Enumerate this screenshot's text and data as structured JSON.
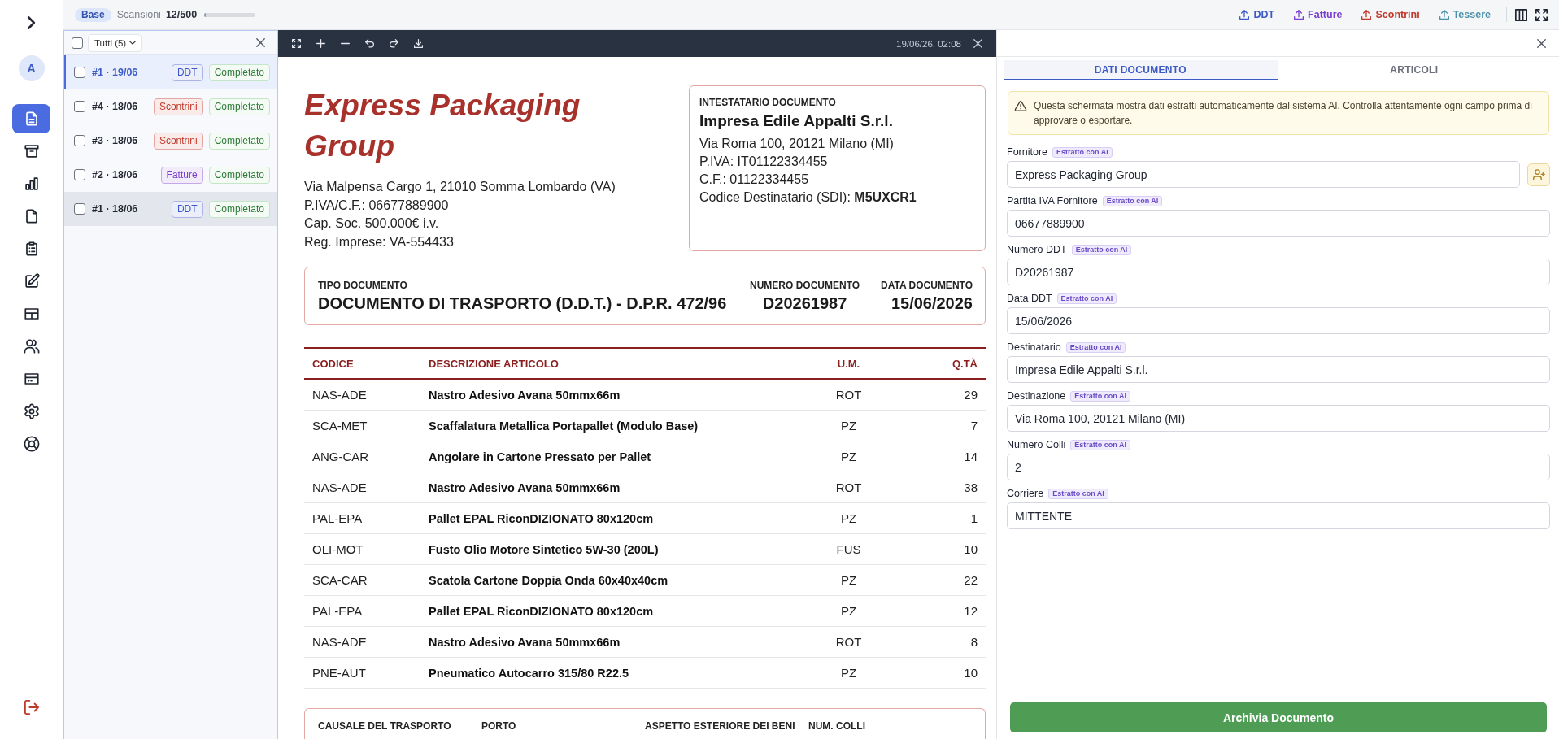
{
  "nav": {
    "avatar": "A",
    "items": [
      {
        "kind": "document",
        "selected": true
      },
      {
        "kind": "archive",
        "selected": false
      },
      {
        "kind": "chart",
        "selected": false
      },
      {
        "kind": "file",
        "selected": false
      },
      {
        "kind": "clipboard",
        "selected": false
      },
      {
        "kind": "edit",
        "selected": false
      },
      {
        "kind": "table",
        "selected": false
      },
      {
        "kind": "users",
        "selected": false
      },
      {
        "kind": "card",
        "selected": false
      },
      {
        "kind": "settings",
        "selected": false
      },
      {
        "kind": "support",
        "selected": false
      }
    ]
  },
  "top_bar": {
    "plan": "Base",
    "scans": {
      "label": "Scansioni",
      "count": "12/500",
      "level": 0.024
    },
    "uploads": [
      {
        "label": "DDT",
        "color": "#3d5bc7"
      },
      {
        "label": "Fatture",
        "color": "#7a3fd0"
      },
      {
        "label": "Scontrini",
        "color": "#c0392b"
      },
      {
        "label": "Tessere",
        "color": "#4a8fab"
      }
    ]
  },
  "scan_list": {
    "select_all_checked": false,
    "filter": "Tutti (5)",
    "items": [
      {
        "title": "#1 · 19/06",
        "type": "DDT",
        "color": "#3d5bc7",
        "status": "Completato",
        "checked": false,
        "selected": true,
        "hovered": false
      },
      {
        "title": "#4 · 18/06",
        "type": "Scontrini",
        "color": "#c0392b",
        "status": "Completato",
        "checked": false,
        "selected": false,
        "hovered": false
      },
      {
        "title": "#3 · 18/06",
        "type": "Scontrini",
        "color": "#c0392b",
        "status": "Completato",
        "checked": false,
        "selected": false,
        "hovered": false
      },
      {
        "title": "#2 · 18/06",
        "type": "Fatture",
        "color": "#7a3fd0",
        "status": "Completato",
        "checked": false,
        "selected": false,
        "hovered": false
      },
      {
        "title": "#1 · 18/06",
        "type": "DDT",
        "color": "#3d5bc7",
        "status": "Completato",
        "checked": false,
        "selected": false,
        "hovered": true
      }
    ]
  },
  "viewer": {
    "timestamp": "19/06/26, 02:08"
  },
  "document": {
    "company": "Express Packaging Group",
    "company_lines": [
      "Via Malpensa Cargo 1, 21010 Somma Lombardo (VA)",
      "P.IVA/C.F.: 06677889900",
      "Cap. Soc. 500.000€ i.v.",
      "Reg. Imprese: VA-554433"
    ],
    "recipient": {
      "heading": "INTESTATARIO DOCUMENTO",
      "name": "Impresa Edile Appalti S.r.l.",
      "lines": [
        "Via Roma 100, 20121 Milano (MI)",
        "P.IVA: IT01122334455",
        "C.F.: 01122334455",
        "Codice Destinatario (SDI): **M5UXCR1**"
      ]
    },
    "info": [
      {
        "label": "TIPO DOCUMENTO",
        "value": "DOCUMENTO DI TRASPORTO (D.D.T.) - D.P.R. 472/96"
      },
      {
        "label": "NUMERO DOCUMENTO",
        "value": "D20261987"
      },
      {
        "label": "DATA DOCUMENTO",
        "value": "15/06/2026"
      }
    ],
    "table": {
      "columns": [
        "CODICE",
        "DESCRIZIONE ARTICOLO",
        "U.M.",
        "Q.TÀ"
      ],
      "rows": [
        [
          "NAS-ADE",
          "Nastro Adesivo Avana 50mmx66m",
          "ROT",
          "29"
        ],
        [
          "SCA-MET",
          "Scaffalatura Metallica Portapallet (Modulo Base)",
          "PZ",
          "7"
        ],
        [
          "ANG-CAR",
          "Angolare in Cartone Pressato per Pallet",
          "PZ",
          "14"
        ],
        [
          "NAS-ADE",
          "Nastro Adesivo Avana 50mmx66m",
          "ROT",
          "38"
        ],
        [
          "PAL-EPA",
          "Pallet EPAL RiconDIZIONATO 80x120cm",
          "PZ",
          "1"
        ],
        [
          "OLI-MOT",
          "Fusto Olio Motore Sintetico 5W-30 (200L)",
          "FUS",
          "10"
        ],
        [
          "SCA-CAR",
          "Scatola Cartone Doppia Onda 60x40x40cm",
          "PZ",
          "22"
        ],
        [
          "PAL-EPA",
          "Pallet EPAL RiconDIZIONATO 80x120cm",
          "PZ",
          "12"
        ],
        [
          "NAS-ADE",
          "Nastro Adesivo Avana 50mmx66m",
          "ROT",
          "8"
        ],
        [
          "PNE-AUT",
          "Pneumatico Autocarro 315/80 R22.5",
          "PZ",
          "10"
        ]
      ]
    },
    "transport_labels": [
      "CAUSALE DEL TRASPORTO",
      "PORTO",
      "ASPETTO ESTERIORE DEI BENI",
      "NUM. COLLI"
    ]
  },
  "details": {
    "tabs": [
      {
        "label": "DATI DOCUMENTO",
        "selected": true
      },
      {
        "label": "ARTICOLI",
        "selected": false
      }
    ],
    "warning": "Questa schermata mostra dati estratti automaticamente dal sistema AI. Controlla attentamente ogni campo prima di approvare o esportare.",
    "fields": [
      {
        "kind": "lookup",
        "label": "Fornitore",
        "badge": "Estratto con AI",
        "value": "Express Packaging Group"
      },
      {
        "kind": "text",
        "label": "Partita IVA Fornitore",
        "badge": "Estratto con AI",
        "value": "06677889900"
      },
      {
        "kind": "text",
        "label": "Numero DDT",
        "badge": "Estratto con AI",
        "value": "D20261987"
      },
      {
        "kind": "text",
        "label": "Data DDT",
        "badge": "Estratto con AI",
        "value": "15/06/2026"
      },
      {
        "kind": "text",
        "label": "Destinatario",
        "badge": "Estratto con AI",
        "value": "Impresa Edile Appalti S.r.l."
      },
      {
        "kind": "text",
        "label": "Destinazione",
        "badge": "Estratto con AI",
        "value": "Via Roma 100, 20121 Milano (MI)"
      },
      {
        "kind": "text",
        "label": "Numero Colli",
        "badge": "Estratto con AI",
        "value": "2"
      },
      {
        "kind": "text",
        "label": "Corriere",
        "badge": "Estratto con AI",
        "value": "MITTENTE"
      }
    ],
    "submit": "Archivia Documento"
  }
}
